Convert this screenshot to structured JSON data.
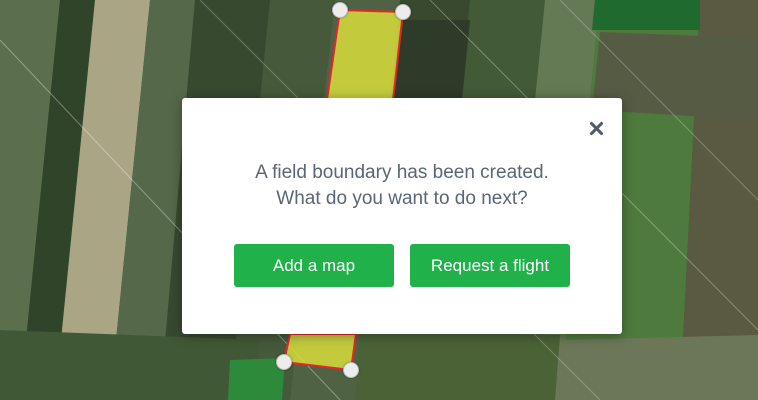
{
  "map": {
    "boundary_stroke": "#e3262b",
    "boundary_fill": "#d7dd3c"
  },
  "dialog": {
    "close_icon": "close-icon",
    "message_line1": "A field boundary has been created.",
    "message_line2": "What do you want to do next?",
    "add_map_label": "Add a map",
    "request_flight_label": "Request a flight",
    "button_color": "#20b14a"
  }
}
